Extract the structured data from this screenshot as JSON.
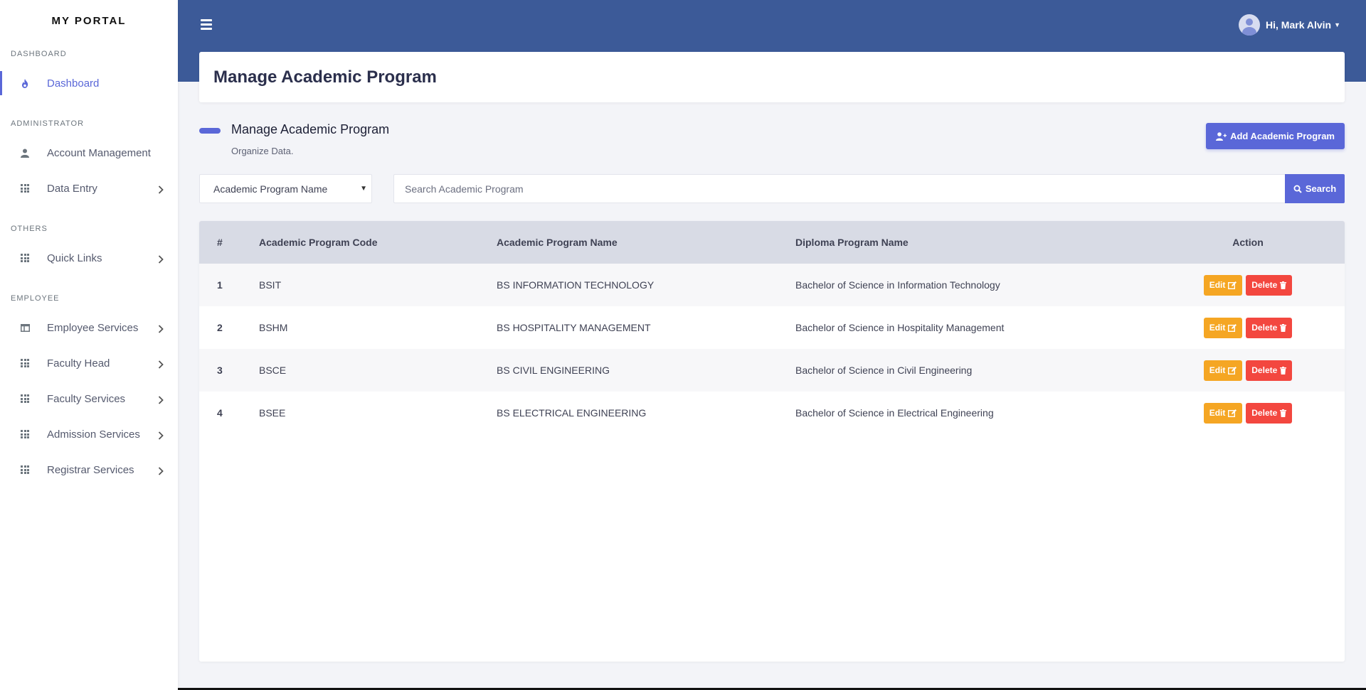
{
  "app": {
    "brand": "MY PORTAL"
  },
  "sidebar": {
    "sections": [
      {
        "title": "DASHBOARD",
        "items": [
          {
            "label": "Dashboard",
            "icon": "fire-icon",
            "active": true
          }
        ]
      },
      {
        "title": "ADMINISTRATOR",
        "items": [
          {
            "label": "Account Management",
            "icon": "user-icon"
          },
          {
            "label": "Data Entry",
            "icon": "grid-icon",
            "expandable": true
          }
        ]
      },
      {
        "title": "OTHERS",
        "items": [
          {
            "label": "Quick Links",
            "icon": "grid-icon",
            "expandable": true
          }
        ]
      },
      {
        "title": "EMPLOYEE",
        "items": [
          {
            "label": "Employee Services",
            "icon": "window-icon",
            "expandable": true
          },
          {
            "label": "Faculty Head",
            "icon": "grid-icon",
            "expandable": true
          },
          {
            "label": "Faculty Services",
            "icon": "grid-icon",
            "expandable": true
          },
          {
            "label": "Admission Services",
            "icon": "grid-icon",
            "expandable": true
          },
          {
            "label": "Registrar Services",
            "icon": "grid-icon",
            "expandable": true
          }
        ]
      }
    ]
  },
  "header": {
    "user_greeting": "Hi, Mark Alvin"
  },
  "page": {
    "title": "Manage Academic Program",
    "section_title": "Manage Academic Program",
    "section_subtitle": "Organize Data.",
    "add_button": "Add Academic Program"
  },
  "filter": {
    "select_value": "Academic Program Name",
    "search_placeholder": "Search Academic Program",
    "search_button": "Search"
  },
  "table": {
    "headers": [
      "#",
      "Academic Program Code",
      "Academic Program Name",
      "Diploma Program Name",
      "Action"
    ],
    "rows": [
      {
        "num": "1",
        "code": "BSIT",
        "name": "BS INFORMATION TECHNOLOGY",
        "diploma": "Bachelor of Science in Information Technology"
      },
      {
        "num": "2",
        "code": "BSHM",
        "name": "BS HOSPITALITY MANAGEMENT",
        "diploma": "Bachelor of Science in Hospitality Management"
      },
      {
        "num": "3",
        "code": "BSCE",
        "name": "BS CIVIL ENGINEERING",
        "diploma": "Bachelor of Science in Civil Engineering"
      },
      {
        "num": "4",
        "code": "BSEE",
        "name": "BS ELECTRICAL ENGINEERING",
        "diploma": "Bachelor of Science in Electrical Engineering"
      }
    ],
    "edit_label": "Edit",
    "delete_label": "Delete"
  },
  "colors": {
    "header_bg": "#3c5a98",
    "accent": "#5a67d8",
    "edit": "#f5a623",
    "delete": "#f3473f"
  }
}
